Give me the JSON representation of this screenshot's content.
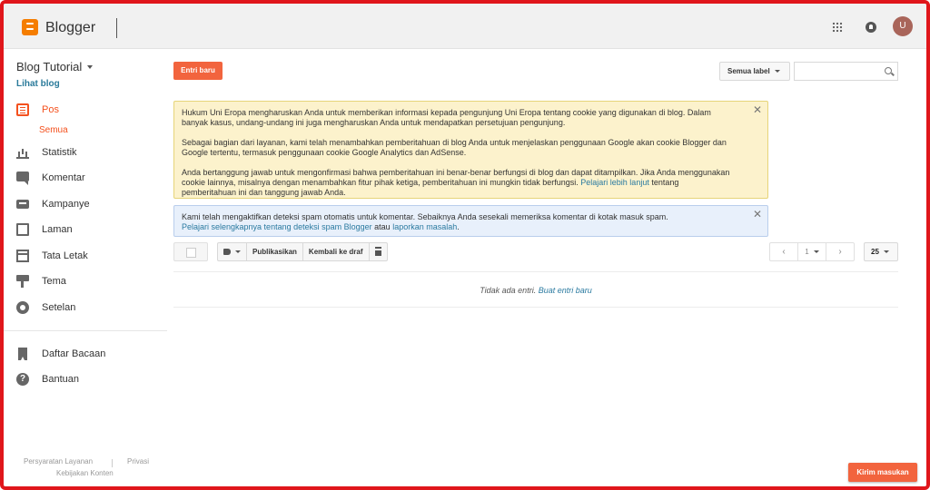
{
  "app": {
    "name": "Blogger",
    "avatar_initial": "U"
  },
  "blog": {
    "title": "Blog Tutorial",
    "view_link": "Lihat blog"
  },
  "sidebar": {
    "items": [
      {
        "label": "Pos",
        "icon": "posts-icon",
        "active": true
      },
      {
        "label": "Statistik",
        "icon": "stats-icon"
      },
      {
        "label": "Komentar",
        "icon": "comment-icon"
      },
      {
        "label": "Kampanye",
        "icon": "campaign-icon"
      },
      {
        "label": "Laman",
        "icon": "pages-icon"
      },
      {
        "label": "Tata Letak",
        "icon": "layout-icon"
      },
      {
        "label": "Tema",
        "icon": "theme-icon"
      },
      {
        "label": "Setelan",
        "icon": "settings-icon"
      }
    ],
    "sub_item": "Semua",
    "secondary_items": [
      {
        "label": "Daftar Bacaan",
        "icon": "reading-list-icon"
      },
      {
        "label": "Bantuan",
        "icon": "help-icon"
      }
    ],
    "footer": {
      "terms": "Persyaratan Layanan",
      "privacy": "Privasi",
      "content_policy": "Kebijakan Konten"
    }
  },
  "main": {
    "new_post_button": "Entri baru",
    "label_filter": "Semua label",
    "search_placeholder": "",
    "cookie_notice": {
      "p1": "Hukum Uni Eropa mengharuskan Anda untuk memberikan informasi kepada pengunjung Uni Eropa tentang cookie yang digunakan di blog. Dalam banyak kasus, undang-undang ini juga mengharuskan Anda untuk mendapatkan persetujuan pengunjung.",
      "p2": "Sebagai bagian dari layanan, kami telah menambahkan pemberitahuan di blog Anda untuk menjelaskan penggunaan Google akan cookie Blogger dan Google tertentu, termasuk penggunaan cookie Google Analytics dan AdSense.",
      "p3": "Anda bertanggung jawab untuk mengonfirmasi bahwa pemberitahuan ini benar-benar berfungsi di blog dan dapat ditampilkan. Jika Anda menggunakan cookie lainnya, misalnya dengan menambahkan fitur pihak ketiga, pemberitahuan ini mungkin tidak berfungsi.",
      "link": "Pelajari lebih lanjut",
      "p3_tail": "tentang pemberitahuan ini dan tanggung jawab Anda."
    },
    "spam_notice": {
      "text": "Kami telah mengaktifkan deteksi spam otomatis untuk komentar. Sebaiknya Anda sesekali memeriksa komentar di kotak masuk spam.",
      "link1": "Pelajari selengkapnya tentang deteksi spam Blogger",
      "joiner": "atau",
      "link2": "laporkan masalah",
      "tail": "."
    },
    "toolbar": {
      "publish": "Publikasikan",
      "revert": "Kembali ke draf"
    },
    "pager": {
      "page": "1",
      "per_page": "25"
    },
    "empty": {
      "text": "Tidak ada entri.",
      "link": "Buat entri baru"
    },
    "feedback_button": "Kirim masukan"
  }
}
